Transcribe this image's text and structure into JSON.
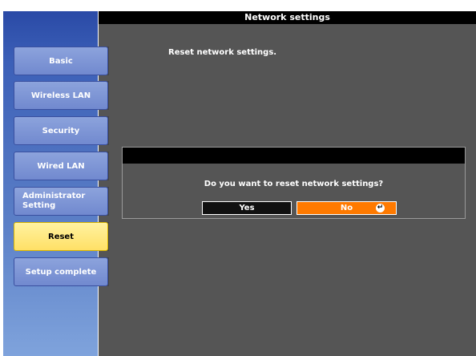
{
  "window": {
    "title": "Network settings"
  },
  "main": {
    "message": "Reset network settings."
  },
  "sidebar": {
    "items": [
      {
        "label": "Basic"
      },
      {
        "label": "Wireless LAN"
      },
      {
        "label": "Security"
      },
      {
        "label": "Wired LAN"
      },
      {
        "label": "Administrator Setting"
      },
      {
        "label": "Reset",
        "active": true
      },
      {
        "label": "Setup complete"
      }
    ]
  },
  "dialog": {
    "question": "Do you want to reset network settings?",
    "yes_label": "Yes",
    "no_label": "No",
    "enter_icon": "enter-icon"
  },
  "colors": {
    "sidebar_accent": "#7189cf",
    "active_tab": "#ffe066",
    "selected_button": "#ff7a00",
    "main_bg": "#555555"
  }
}
